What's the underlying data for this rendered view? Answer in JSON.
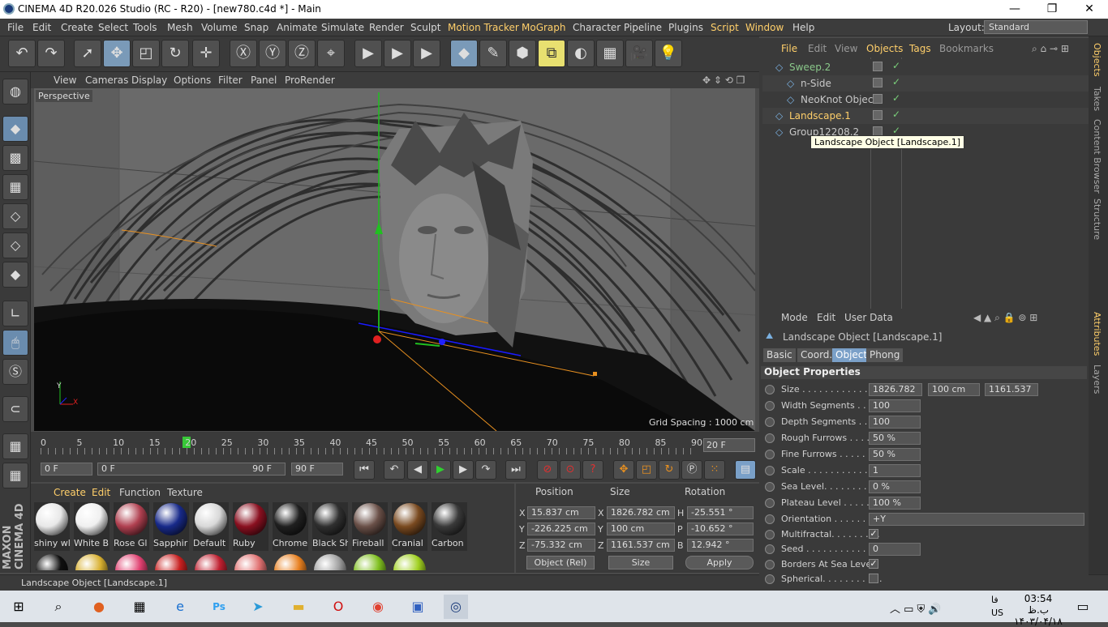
{
  "window": {
    "title": "CINEMA 4D R20.026 Studio (RC - R20) - [new780.c4d *] - Main",
    "min": "—",
    "max": "❐",
    "close": "✕"
  },
  "menubar": {
    "items": [
      "File",
      "Edit",
      "Create",
      "Select",
      "Tools",
      "Mesh",
      "Volume",
      "Snap",
      "Animate",
      "Simulate",
      "Render",
      "Sculpt",
      "Motion Tracker",
      "MoGraph",
      "Character",
      "Pipeline",
      "Plugins",
      "Script",
      "Window",
      "Help"
    ],
    "layout_label": "Layout:",
    "layout_value": "Standard"
  },
  "viewport": {
    "menu": [
      "View",
      "Cameras",
      "Display",
      "Options",
      "Filter",
      "Panel",
      "ProRender"
    ],
    "camera": "Perspective",
    "grid_spacing": "Grid Spacing : 1000 cm"
  },
  "timeline": {
    "ticks": [
      "0",
      "5",
      "10",
      "15",
      "20",
      "25",
      "30",
      "35",
      "40",
      "45",
      "50",
      "55",
      "60",
      "65",
      "70",
      "75",
      "80",
      "85",
      "90"
    ],
    "current_frame": "20 F",
    "start": "0 F",
    "range_start": "0 F",
    "range_end": "90 F",
    "end": "90 F",
    "playhead_frame": 20,
    "max_frame": 90
  },
  "materials": {
    "menu": [
      "Create",
      "Edit",
      "Function",
      "Texture"
    ],
    "items": [
      {
        "name": "shiny wl",
        "color": "#e8e8e8"
      },
      {
        "name": "White B",
        "color": "#f0f0f0"
      },
      {
        "name": "Rose Gl",
        "color": "#b04050"
      },
      {
        "name": "Sapphir",
        "color": "#182a8a"
      },
      {
        "name": "Default",
        "color": "#d8d8d8"
      },
      {
        "name": "Ruby",
        "color": "#8a1020"
      },
      {
        "name": "Chrome",
        "color": "#202020"
      },
      {
        "name": "Black Sh",
        "color": "#303030"
      },
      {
        "name": "Fireball",
        "color": "#6a5048"
      },
      {
        "name": "Cranial",
        "color": "#7a4a20"
      },
      {
        "name": "Carbon",
        "color": "#3a3a3a"
      }
    ],
    "row2_colors": [
      "#101010",
      "#d8b030",
      "#e04070",
      "#c82020",
      "#c02030",
      "#e07070",
      "#e88020",
      "#a0a0a0",
      "#80c020",
      "#a0d020"
    ]
  },
  "coordinates": {
    "headers": {
      "position": "Position",
      "size": "Size",
      "rotation": "Rotation"
    },
    "rows": [
      {
        "axis": "X",
        "pos": "15.837 cm",
        "size_axis": "X",
        "size": "1826.782 cm",
        "rot_axis": "H",
        "rot": "-25.551 °"
      },
      {
        "axis": "Y",
        "pos": "-226.225 cm",
        "size_axis": "Y",
        "size": "100 cm",
        "rot_axis": "P",
        "rot": "-10.652 °"
      },
      {
        "axis": "Z",
        "pos": "-75.332 cm",
        "size_axis": "Z",
        "size": "1161.537 cm",
        "rot_axis": "B",
        "rot": "12.942 °"
      }
    ],
    "mode": "Object (Rel)",
    "size_mode": "Size",
    "apply": "Apply"
  },
  "status": "Landscape Object [Landscape.1]",
  "objects": {
    "menu": [
      "File",
      "Edit",
      "View",
      "Objects",
      "Tags",
      "Bookmarks"
    ],
    "items": [
      {
        "name": "Sweep.2",
        "indent": 0,
        "color": "#8ac88a"
      },
      {
        "name": "n-Side",
        "indent": 1,
        "color": "#c8c8c8"
      },
      {
        "name": "NeoKnot Object",
        "indent": 1,
        "color": "#c8c8c8"
      },
      {
        "name": "Landscape.1",
        "indent": 0,
        "color": "#ffcf6a"
      },
      {
        "name": "Group12208.2",
        "indent": 0,
        "color": "#c8c8c8"
      }
    ],
    "tooltip": "Landscape Object [Landscape.1]"
  },
  "attributes": {
    "menu": [
      "Mode",
      "Edit",
      "User Data"
    ],
    "title": "Landscape Object [Landscape.1]",
    "tabs": [
      "Basic",
      "Coord.",
      "Object",
      "Phong"
    ],
    "active_tab": "Object",
    "section": "Object Properties",
    "props": [
      {
        "label": "Size . . . . . . . . . . . . . . .",
        "values": [
          "1826.782",
          "100 cm",
          "1161.537"
        ]
      },
      {
        "label": "Width Segments . . . .",
        "values": [
          "100"
        ]
      },
      {
        "label": "Depth Segments . . . .",
        "values": [
          "100"
        ]
      },
      {
        "label": "Rough Furrows . . . . .",
        "values": [
          "50 %"
        ]
      },
      {
        "label": "Fine Furrows . . . . . . .",
        "values": [
          "50 %"
        ]
      },
      {
        "label": "Scale . . . . . . . . . . . . . .",
        "values": [
          "1"
        ]
      },
      {
        "label": "Sea Level. . . . . . . . . . .",
        "values": [
          "0 %"
        ]
      },
      {
        "label": "Plateau Level . . . . . . .",
        "values": [
          "100 %"
        ]
      },
      {
        "label": "Orientation . . . . . . . . .",
        "values": [
          "+Y"
        ]
      },
      {
        "label": "Multifractal. . . . . . . . .",
        "check": "✓"
      },
      {
        "label": "Seed . . . . . . . . . . . . . . .",
        "values": [
          "0"
        ]
      },
      {
        "label": "Borders At Sea Level",
        "check": "✓"
      },
      {
        "label": "Spherical. . . . . . . . . . .",
        "check": ""
      }
    ]
  },
  "right_tabs": [
    "Objects",
    "Takes",
    "Content Browser",
    "Structure",
    "Attributes",
    "Layers"
  ],
  "taskbar": {
    "time": "03:54 ب.ظ",
    "date": "۱۴۰۳/۰۴/۱۸",
    "lang": "US",
    "lang2": "فا"
  }
}
